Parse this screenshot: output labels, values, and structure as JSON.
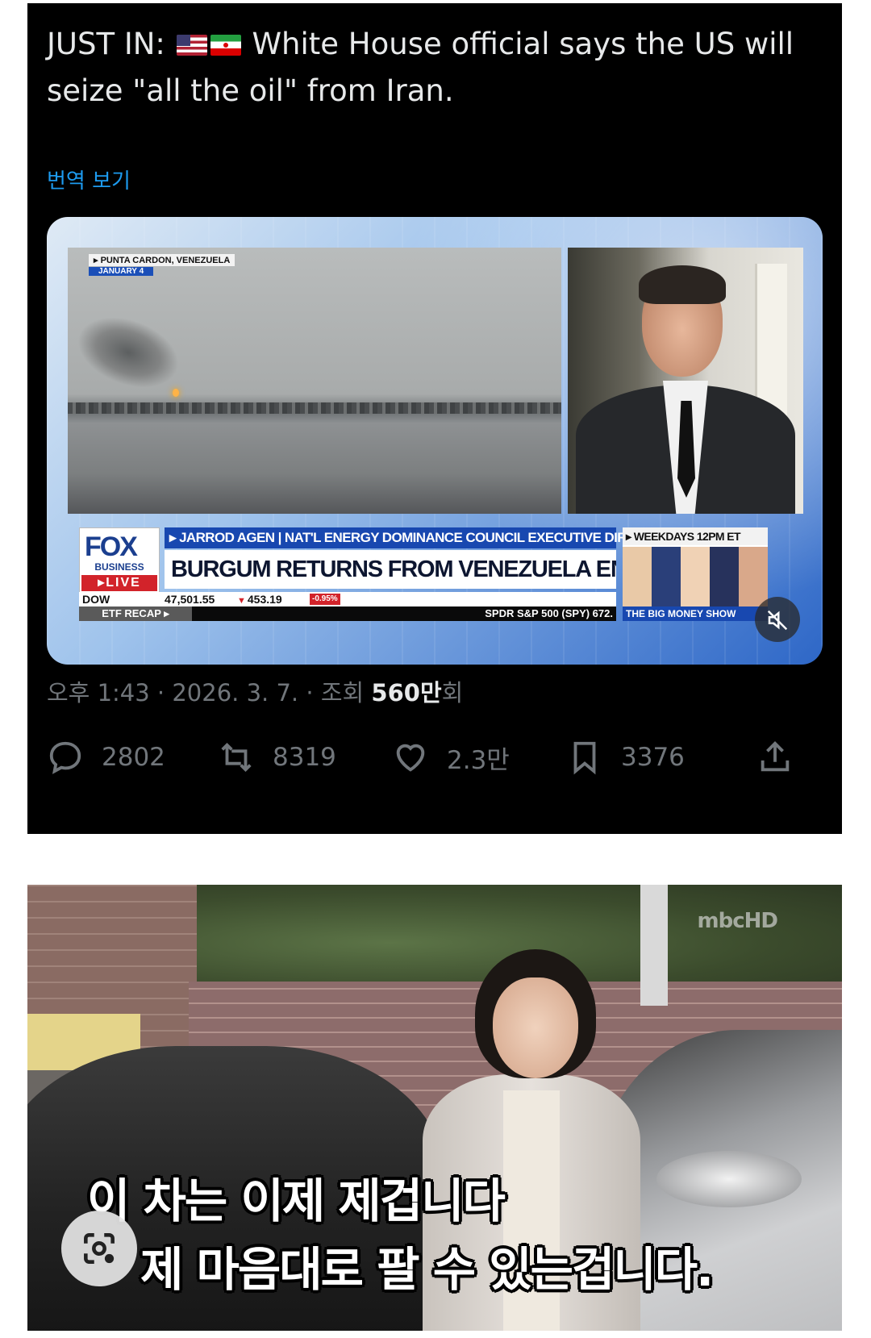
{
  "tweet": {
    "text_prefix": "JUST IN:",
    "flags": [
      "us-flag",
      "iran-flag"
    ],
    "text_body": "White House official says the US will seize \"all the oil\" from Iran.",
    "translate_label": "번역 보기",
    "meta": {
      "time": "오후 1:43",
      "date": "2026. 3. 7.",
      "views_label": "조회",
      "views_value": "560만",
      "views_suffix": "회"
    },
    "actions": {
      "replies": "2802",
      "reposts": "8319",
      "likes": "2.3만",
      "bookmarks": "3376"
    }
  },
  "news_media": {
    "location": "PUNTA CARDON, VENEZUELA",
    "date": "JANUARY 4",
    "channel_logo": "FOX",
    "channel_sub": "BUSINESS",
    "live_label": "LIVE",
    "name_bar": "JARROD AGEN | NAT'L ENERGY DOMINANCE COUNCIL EXECUTIVE DIRECTOR",
    "headline": "BURGUM RETURNS FROM VENEZUELA ENERGY TOUR",
    "ticker": {
      "index": "DOW",
      "value": "47,501.55",
      "change": "453.19",
      "percent": "-0.95%"
    },
    "etf_label": "ETF RECAP",
    "etf_ticker": "SPDR S&P 500 (SPY) 672.",
    "promo_top": "WEEKDAYS 12PM ET",
    "promo_bottom": "THE BIG MONEY SHOW",
    "mute_icon": "muted-speaker-icon"
  },
  "second_image": {
    "watermark": "mbcHD",
    "subtitle_line1": "이 차는 이제 제겁니다",
    "subtitle_line2": "제 마음대로 팔 수 있는겁니다.",
    "lens_icon": "image-search-lens-icon"
  },
  "colors": {
    "tweet_bg": "#000000",
    "tweet_text": "#e7e9ea",
    "muted_text": "#71767b",
    "link_blue": "#1d9bf0",
    "fox_blue": "#1848b0",
    "fox_red": "#d2232a"
  }
}
